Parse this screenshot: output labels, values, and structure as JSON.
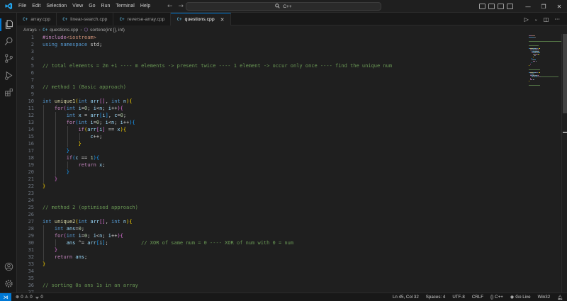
{
  "menu": [
    "File",
    "Edit",
    "Selection",
    "View",
    "Go",
    "Run",
    "Terminal",
    "Help"
  ],
  "search": {
    "label": "C++"
  },
  "tabs": [
    {
      "label": "array.cpp",
      "active": false
    },
    {
      "label": "linear-search.cpp",
      "active": false
    },
    {
      "label": "reverse-array.cpp",
      "active": false
    },
    {
      "label": "questions.cpp",
      "active": true
    }
  ],
  "breadcrumb": {
    "folder": "Arrays",
    "file": "questions.cpp",
    "symbol": "sortone(int [], int)"
  },
  "code_lines": [
    [
      [
        "pre",
        "#include"
      ],
      [
        "str",
        "<iostream>"
      ]
    ],
    [
      [
        "kw",
        "using"
      ],
      [
        "plain",
        " "
      ],
      [
        "kw",
        "namespace"
      ],
      [
        "plain",
        " std;"
      ]
    ],
    [],
    [],
    [
      [
        "cmt",
        "// total elements = 2m +1 ---- m elements -> present twice ---- 1 element -> occur only once ---- find the unique num"
      ]
    ],
    [],
    [],
    [
      [
        "cmt",
        "// method 1 (Basic approach)"
      ]
    ],
    [],
    [
      [
        "kw",
        "int"
      ],
      [
        "plain",
        " "
      ],
      [
        "fn",
        "unique1"
      ],
      [
        "br1",
        "("
      ],
      [
        "kw",
        "int"
      ],
      [
        "plain",
        " "
      ],
      [
        "var",
        "arr"
      ],
      [
        "br2",
        "[]"
      ],
      [
        "plain",
        ", "
      ],
      [
        "kw",
        "int"
      ],
      [
        "plain",
        " "
      ],
      [
        "var",
        "n"
      ],
      [
        "br1",
        ")"
      ],
      [
        "br1",
        "{"
      ]
    ],
    [
      [
        "plain",
        "    "
      ],
      [
        "ctrl",
        "for"
      ],
      [
        "br2",
        "("
      ],
      [
        "kw",
        "int"
      ],
      [
        "plain",
        " "
      ],
      [
        "var",
        "i"
      ],
      [
        "plain",
        "="
      ],
      [
        "num",
        "0"
      ],
      [
        "plain",
        "; "
      ],
      [
        "var",
        "i"
      ],
      [
        "plain",
        "<"
      ],
      [
        "var",
        "n"
      ],
      [
        "plain",
        "; "
      ],
      [
        "var",
        "i"
      ],
      [
        "plain",
        "++"
      ],
      [
        "br2",
        ")"
      ],
      [
        "br2",
        "{"
      ]
    ],
    [
      [
        "plain",
        "        "
      ],
      [
        "kw",
        "int"
      ],
      [
        "plain",
        " "
      ],
      [
        "var",
        "x"
      ],
      [
        "plain",
        " = "
      ],
      [
        "var",
        "arr"
      ],
      [
        "br3",
        "["
      ],
      [
        "var",
        "i"
      ],
      [
        "br3",
        "]"
      ],
      [
        "plain",
        ", "
      ],
      [
        "var",
        "c"
      ],
      [
        "plain",
        "="
      ],
      [
        "num",
        "0"
      ],
      [
        "plain",
        ";"
      ]
    ],
    [
      [
        "plain",
        "        "
      ],
      [
        "ctrl",
        "for"
      ],
      [
        "br3",
        "("
      ],
      [
        "kw",
        "int"
      ],
      [
        "plain",
        " "
      ],
      [
        "var",
        "i"
      ],
      [
        "plain",
        "="
      ],
      [
        "num",
        "0"
      ],
      [
        "plain",
        "; "
      ],
      [
        "var",
        "i"
      ],
      [
        "plain",
        "<"
      ],
      [
        "var",
        "n"
      ],
      [
        "plain",
        "; "
      ],
      [
        "var",
        "i"
      ],
      [
        "plain",
        "++"
      ],
      [
        "br3",
        ")"
      ],
      [
        "br3",
        "{"
      ]
    ],
    [
      [
        "plain",
        "            "
      ],
      [
        "ctrl",
        "if"
      ],
      [
        "br1",
        "("
      ],
      [
        "var",
        "arr"
      ],
      [
        "br2",
        "["
      ],
      [
        "var",
        "i"
      ],
      [
        "br2",
        "]"
      ],
      [
        "plain",
        " == "
      ],
      [
        "var",
        "x"
      ],
      [
        "br1",
        ")"
      ],
      [
        "br1",
        "{"
      ]
    ],
    [
      [
        "plain",
        "                "
      ],
      [
        "var",
        "c"
      ],
      [
        "plain",
        "++;"
      ]
    ],
    [
      [
        "plain",
        "            "
      ],
      [
        "br1",
        "}"
      ]
    ],
    [
      [
        "plain",
        "        "
      ],
      [
        "br3",
        "}"
      ]
    ],
    [
      [
        "plain",
        "        "
      ],
      [
        "ctrl",
        "if"
      ],
      [
        "br3",
        "("
      ],
      [
        "var",
        "c"
      ],
      [
        "plain",
        " == "
      ],
      [
        "num",
        "1"
      ],
      [
        "br3",
        ")"
      ],
      [
        "br3",
        "{"
      ]
    ],
    [
      [
        "plain",
        "            "
      ],
      [
        "ctrl",
        "return"
      ],
      [
        "plain",
        " "
      ],
      [
        "var",
        "x"
      ],
      [
        "plain",
        ";"
      ]
    ],
    [
      [
        "plain",
        "        "
      ],
      [
        "br3",
        "}"
      ]
    ],
    [
      [
        "plain",
        "    "
      ],
      [
        "br2",
        "}"
      ]
    ],
    [
      [
        "br1",
        "}"
      ]
    ],
    [],
    [],
    [
      [
        "cmt",
        "// method 2 (optimised approach)"
      ]
    ],
    [],
    [
      [
        "kw",
        "int"
      ],
      [
        "plain",
        " "
      ],
      [
        "fn",
        "unique2"
      ],
      [
        "br1",
        "("
      ],
      [
        "kw",
        "int"
      ],
      [
        "plain",
        " "
      ],
      [
        "var",
        "arr"
      ],
      [
        "br2",
        "[]"
      ],
      [
        "plain",
        ", "
      ],
      [
        "kw",
        "int"
      ],
      [
        "plain",
        " "
      ],
      [
        "var",
        "n"
      ],
      [
        "br1",
        ")"
      ],
      [
        "br1",
        "{"
      ]
    ],
    [
      [
        "plain",
        "    "
      ],
      [
        "kw",
        "int"
      ],
      [
        "plain",
        " "
      ],
      [
        "var",
        "ans"
      ],
      [
        "plain",
        "="
      ],
      [
        "num",
        "0"
      ],
      [
        "plain",
        ";"
      ]
    ],
    [
      [
        "plain",
        "    "
      ],
      [
        "ctrl",
        "for"
      ],
      [
        "br2",
        "("
      ],
      [
        "kw",
        "int"
      ],
      [
        "plain",
        " "
      ],
      [
        "var",
        "i"
      ],
      [
        "plain",
        "="
      ],
      [
        "num",
        "0"
      ],
      [
        "plain",
        "; "
      ],
      [
        "var",
        "i"
      ],
      [
        "plain",
        "<"
      ],
      [
        "var",
        "n"
      ],
      [
        "plain",
        "; "
      ],
      [
        "var",
        "i"
      ],
      [
        "plain",
        "++"
      ],
      [
        "br2",
        ")"
      ],
      [
        "br2",
        "{"
      ]
    ],
    [
      [
        "plain",
        "        "
      ],
      [
        "var",
        "ans"
      ],
      [
        "plain",
        " ^= "
      ],
      [
        "var",
        "arr"
      ],
      [
        "br3",
        "["
      ],
      [
        "var",
        "i"
      ],
      [
        "br3",
        "]"
      ],
      [
        "plain",
        ";           "
      ],
      [
        "cmt",
        "// XOR of same num = 0 ---- XOR of num with 0 = num"
      ]
    ],
    [
      [
        "plain",
        "    "
      ],
      [
        "br2",
        "}"
      ]
    ],
    [
      [
        "plain",
        "    "
      ],
      [
        "ctrl",
        "return"
      ],
      [
        "plain",
        " "
      ],
      [
        "var",
        "ans"
      ],
      [
        "plain",
        ";"
      ]
    ],
    [
      [
        "br1",
        "}"
      ]
    ],
    [],
    [],
    [
      [
        "cmt",
        "// sorting 0s ans 1s in an array"
      ]
    ],
    []
  ],
  "status": {
    "errors": "0",
    "warnings": "0",
    "ports": "0",
    "position": "Ln 45, Col 32",
    "spaces": "Spaces: 4",
    "encoding": "UTF-8",
    "eol": "CRLF",
    "language": "C++",
    "golive": "Go Live",
    "platform": "Win32"
  },
  "colors": {
    "accent": "#0078d4",
    "background": "#1f1f1f",
    "sidebar": "#181818"
  }
}
